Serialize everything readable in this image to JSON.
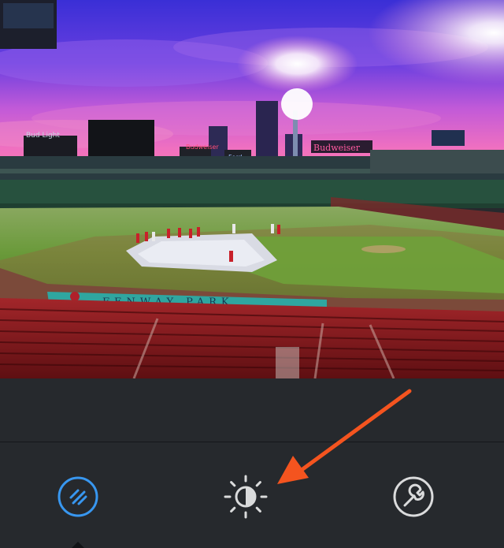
{
  "photo": {
    "signs": {
      "fenway": "FENWAY PARK",
      "budweiser_top": "Budweiser",
      "budweiser_left": "Bud Light",
      "ford": "Ford",
      "ticker": "Budweiser"
    }
  },
  "toolbar": {
    "filter_icon": "filter-icon",
    "adjust_icon": "brightness-icon",
    "tools_icon": "wrench-icon",
    "active_color": "#3897f0",
    "inactive_color": "#dadbdc"
  },
  "annotation": {
    "arrow_color": "#f4541f"
  }
}
